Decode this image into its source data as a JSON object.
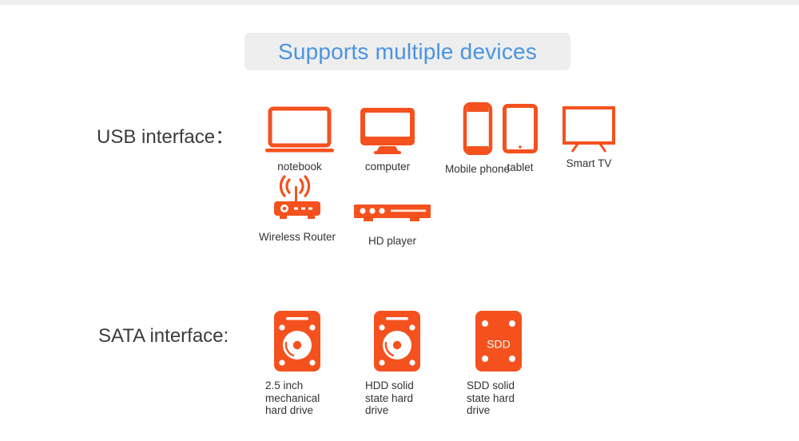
{
  "colors": {
    "accent_orange": "#f4511e",
    "title_blue": "#4a94e0",
    "banner_bg": "#eeeeee",
    "text": "#333333",
    "page_bg": "#ffffff"
  },
  "banner": {
    "title": "Supports multiple devices"
  },
  "sections": [
    {
      "id": "usb",
      "label": "USB interface：",
      "devices": [
        {
          "id": "notebook",
          "label": "notebook",
          "icon": "laptop-icon"
        },
        {
          "id": "computer",
          "label": "computer",
          "icon": "desktop-monitor-icon"
        },
        {
          "id": "phone",
          "label": "Mobile phone",
          "icon": "smartphone-icon"
        },
        {
          "id": "tablet",
          "label": "tablet",
          "icon": "tablet-icon"
        },
        {
          "id": "smarttv",
          "label": "Smart TV",
          "icon": "television-icon"
        },
        {
          "id": "router",
          "label": "Wireless Router",
          "icon": "wifi-router-icon"
        },
        {
          "id": "hdplayer",
          "label": "HD player",
          "icon": "media-player-icon"
        }
      ]
    },
    {
      "id": "sata",
      "label": "SATA interface:",
      "devices": [
        {
          "id": "hdd1",
          "label": "2.5 inch mechanical hard drive",
          "icon": "hard-disk-icon",
          "badge": ""
        },
        {
          "id": "hdd2",
          "label": "HDD solid state hard drive",
          "icon": "hard-disk-icon",
          "badge": ""
        },
        {
          "id": "sdd",
          "label": "SDD solid state hard drive",
          "icon": "solid-state-disk-icon",
          "badge": "SDD"
        }
      ]
    }
  ]
}
